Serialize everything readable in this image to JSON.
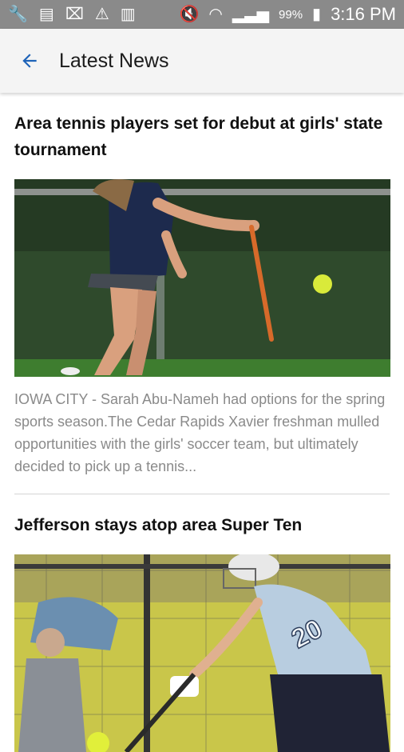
{
  "status_bar": {
    "battery": "99%",
    "time": "3:16 PM"
  },
  "app_bar": {
    "title": "Latest News"
  },
  "articles": [
    {
      "headline": "Area tennis players set for debut at girls' state tournament",
      "summary": "IOWA CITY - Sarah Abu-Nameh had options for the spring sports season.The Cedar Rapids Xavier freshman mulled opportunities with the girls' soccer team, but ultimately decided to pick up a tennis..."
    },
    {
      "headline": "Jefferson stays atop area Super Ten",
      "jersey_number": "20"
    }
  ]
}
